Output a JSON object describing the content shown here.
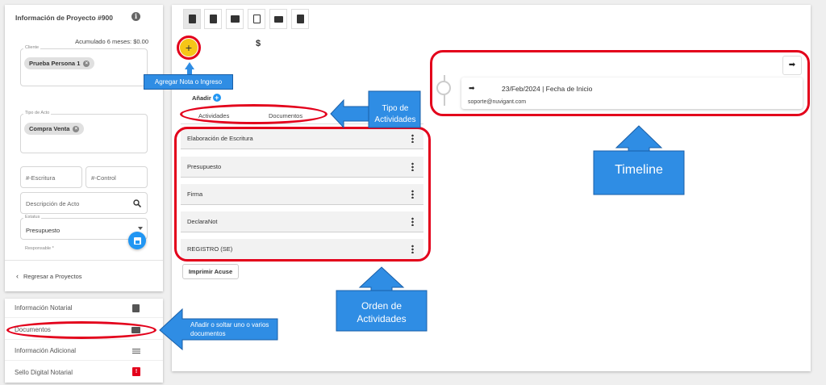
{
  "left_panel": {
    "title": "Información de Proyecto #900",
    "acumulado": "Acumulado 6 meses: $0.00",
    "cliente_label": "Cliente",
    "cliente_chip": "Prueba Persona 1",
    "tipo_acto_label": "Tipo de Acto",
    "tipo_acto_chip": "Compra Venta",
    "escritura_placeholder": "#-Escritura",
    "control_placeholder": "#-Control",
    "descripcion_placeholder": "Descripción de Acto",
    "estatus_label": "Estatus",
    "estatus_value": "Presupuesto",
    "responsable_label": "Responsable *",
    "back_label": "Regresar a Proyectos"
  },
  "side_nav": [
    {
      "label": "Información Notarial",
      "icon": "notebook-icon"
    },
    {
      "label": "Documentos",
      "icon": "folder-icon"
    },
    {
      "label": "Información Adicional",
      "icon": "list-icon"
    },
    {
      "label": "Sello Digital Notarial",
      "icon": "seal-icon"
    }
  ],
  "main": {
    "currency": "$",
    "add_label": "Añadir",
    "tabs": [
      "Actividades",
      "Documentos"
    ],
    "activities": [
      "Elaboración de Escritura",
      "Presupuesto",
      "Firma",
      "DeclaraNot",
      "REGISTRO (SE)"
    ],
    "print_button": "Imprimir Acuse",
    "timeline": {
      "date_text": "23/Feb/2024 | Fecha de Inicio",
      "email": "soporte@nuvigant.com"
    }
  },
  "callouts": {
    "agregar": "Agregar Nota o Ingreso",
    "tipo": "Tipo de Actividades",
    "timeline": "Timeline",
    "orden": "Orden de Actividades",
    "anadir_docs": "Añadir o soltar uno o varios documentos"
  },
  "colors": {
    "accent_red": "#e3001b",
    "callout_blue": "#2f8de4",
    "add_button_yellow": "#f5c518",
    "save_blue": "#2196f3"
  }
}
